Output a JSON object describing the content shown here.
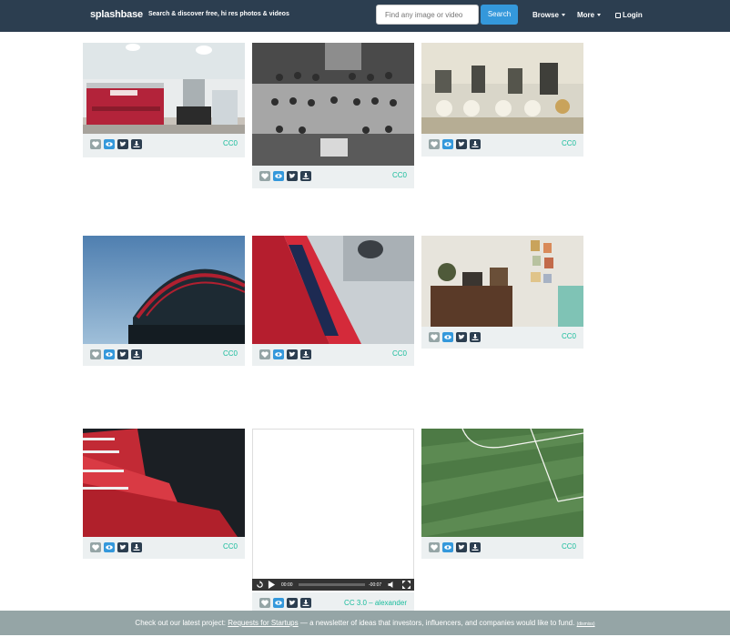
{
  "navbar": {
    "brand": "splashbase",
    "tagline": "Search & discover free, hi res photos & videos",
    "search_placeholder": "Find any image or video",
    "search_button": "Search",
    "browse": "Browse",
    "more": "More",
    "login": "Login"
  },
  "cards": [
    {
      "license": "CC0",
      "subject": "red espresso machine"
    },
    {
      "license": "CC0",
      "subject": "vintage hockey team photo"
    },
    {
      "license": "CC0",
      "subject": "coffee grinders and scales"
    },
    {
      "license": "CC0",
      "subject": "stadium roof arch"
    },
    {
      "license": "CC0",
      "subject": "red scarf at stadium"
    },
    {
      "license": "CC0",
      "subject": "vintage room with phonograph"
    },
    {
      "license": "CC0",
      "subject": "stadium crowd in red"
    },
    {
      "license": "CC0",
      "subject": "football pitch grass"
    }
  ],
  "video": {
    "time_current": "00:00",
    "time_remaining": "-00:07",
    "license": "CC 3.0",
    "separator": " – ",
    "author": "alexander"
  },
  "footer": {
    "text_before": "Check out our latest project: ",
    "link": "Requests for Startups",
    "text_after": " — a newsletter of ideas that investors, influencers, and companies would like to fund.",
    "dismiss": "(dismiss)"
  },
  "colors": {
    "navbar": "#2c3e50",
    "accent": "#3498db",
    "license": "#18bc9c",
    "card_bg": "#ecf0f1",
    "footer": "#95a5a6"
  }
}
